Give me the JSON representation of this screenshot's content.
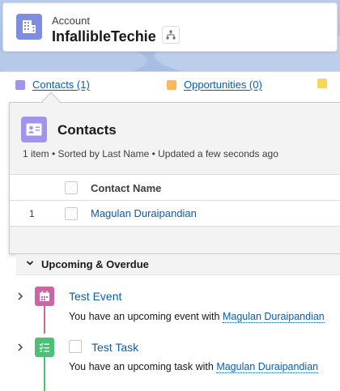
{
  "header": {
    "object_label": "Account",
    "record_name": "InfallibleTechie"
  },
  "related": {
    "contacts_link": "Contacts (1)",
    "opportunities_link": "Opportunities (0)"
  },
  "popover": {
    "title": "Contacts",
    "meta": "1 item • Sorted by Last Name • Updated a few seconds ago",
    "column_header": "Contact Name",
    "rows": [
      {
        "num": "1",
        "name": "Magulan Duraipandian"
      }
    ]
  },
  "activity": {
    "section_title": "Upcoming & Overdue",
    "items": [
      {
        "title": "Test Event",
        "prefix": "You have an upcoming event with",
        "who": "Magulan Duraipandian"
      },
      {
        "title": "Test Task",
        "prefix": "You have an upcoming task with",
        "who": "Magulan Duraipandian"
      }
    ]
  },
  "colors": {
    "account_icon": "#7f8de1",
    "contacts_icon": "#a094ed",
    "event_icon": "#cb65a3",
    "task_icon": "#4bc076",
    "link": "#0b5cab"
  }
}
